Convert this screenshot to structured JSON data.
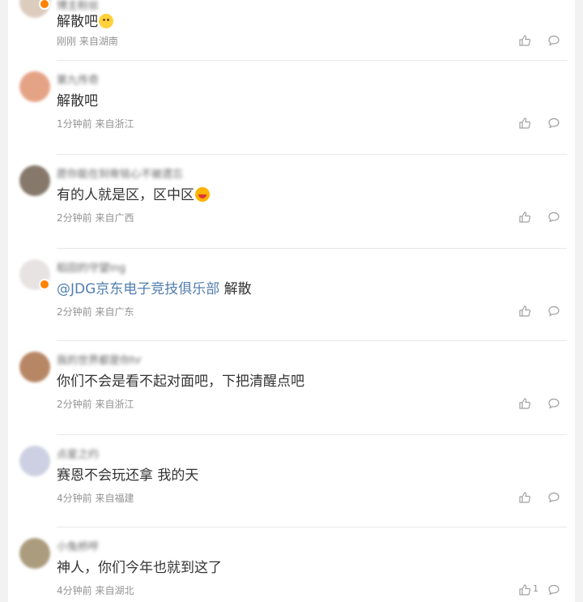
{
  "comments": [
    {
      "user": "博主粉丝",
      "text": "解散吧",
      "emoji": "smile",
      "time": "刚刚",
      "location": "来自湖南",
      "badge": true,
      "avatar_color": "#d9c7b8",
      "likes": ""
    },
    {
      "user": "第九传奇",
      "text": "解散吧",
      "emoji": "",
      "time": "1分钟前",
      "location": "来自浙江",
      "badge": false,
      "avatar_color": "#e39a7a",
      "likes": ""
    },
    {
      "user": "愿你能在刻骨铭心不被遗忘",
      "text": "有的人就是区，区中区",
      "emoji": "laugh",
      "time": "2分钟前",
      "location": "来自广西",
      "badge": false,
      "avatar_color": "#7a6a5a",
      "likes": ""
    },
    {
      "user": "稻田的守望ing",
      "mention": "@JDG京东电子竞技俱乐部",
      "text": " 解散",
      "emoji": "",
      "time": "2分钟前",
      "location": "来自广东",
      "badge": true,
      "avatar_color": "#e6e0e0",
      "likes": ""
    },
    {
      "user": "我的世界都是你hr",
      "text": "你们不会是看不起对面吧，下把清醒点吧",
      "emoji": "",
      "time": "2分钟前",
      "location": "来自浙江",
      "badge": false,
      "avatar_color": "#b07a55",
      "likes": ""
    },
    {
      "user": "点星之约",
      "text": "赛恩不会玩还拿 我的天",
      "emoji": "",
      "time": "4分钟前",
      "location": "来自福建",
      "badge": false,
      "avatar_color": "#c8cce0",
      "likes": ""
    },
    {
      "user": "小兔桥呼",
      "text": "神人，你们今年也就到这了",
      "emoji": "",
      "time": "4分钟前",
      "location": "来自湖北",
      "badge": false,
      "avatar_color": "#a39270",
      "likes": "1"
    }
  ],
  "colors": {
    "mention": "#507daf",
    "meta": "#939393",
    "text": "#333333"
  },
  "icons": {
    "like": "thumbs-up-icon",
    "reply": "comment-bubble-icon"
  }
}
